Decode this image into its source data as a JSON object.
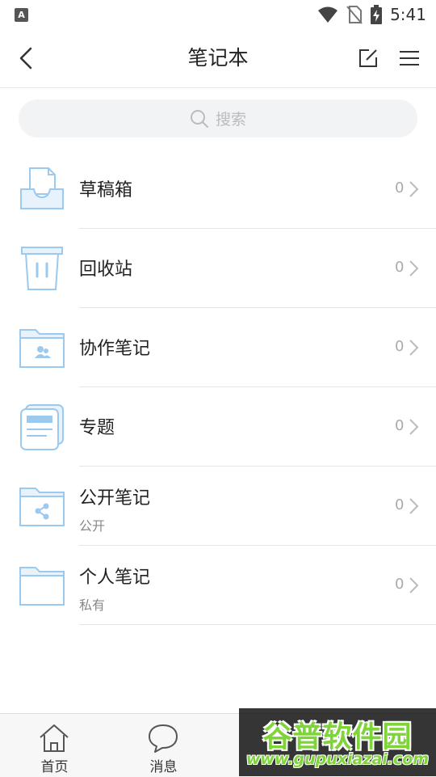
{
  "status_bar": {
    "app_icon_letter": "A",
    "time": "5:41",
    "icons": [
      "wifi-icon",
      "no-sim-icon",
      "battery-charging-icon"
    ]
  },
  "header": {
    "title": "笔记本",
    "back_icon": "chevron-left-icon",
    "edit_icon": "edit-note-icon",
    "menu_icon": "hamburger-menu-icon"
  },
  "search": {
    "placeholder": "搜索",
    "icon": "search-icon"
  },
  "notebooks": [
    {
      "title": "草稿箱",
      "subtitle": "",
      "count": "0",
      "icon": "drafts-tray-icon"
    },
    {
      "title": "回收站",
      "subtitle": "",
      "count": "0",
      "icon": "trash-icon"
    },
    {
      "title": "协作笔记",
      "subtitle": "",
      "count": "0",
      "icon": "shared-folder-icon"
    },
    {
      "title": "专题",
      "subtitle": "",
      "count": "0",
      "icon": "topic-icon"
    },
    {
      "title": "公开笔记",
      "subtitle": "公开",
      "count": "0",
      "icon": "public-folder-icon"
    },
    {
      "title": "个人笔记",
      "subtitle": "私有",
      "count": "0",
      "icon": "folder-icon"
    }
  ],
  "bottom_nav": [
    {
      "label": "首页",
      "icon": "home-icon"
    },
    {
      "label": "消息",
      "icon": "message-icon"
    }
  ],
  "watermark": {
    "logo_text": "谷普软件园",
    "url": "www.gupuxiazai.com"
  },
  "colors": {
    "icon_blue": "#9cc9ee",
    "icon_fill": "#e7f2fc",
    "text_primary": "#222222",
    "text_secondary": "#888888",
    "watermark_green": "#7fd43a"
  }
}
